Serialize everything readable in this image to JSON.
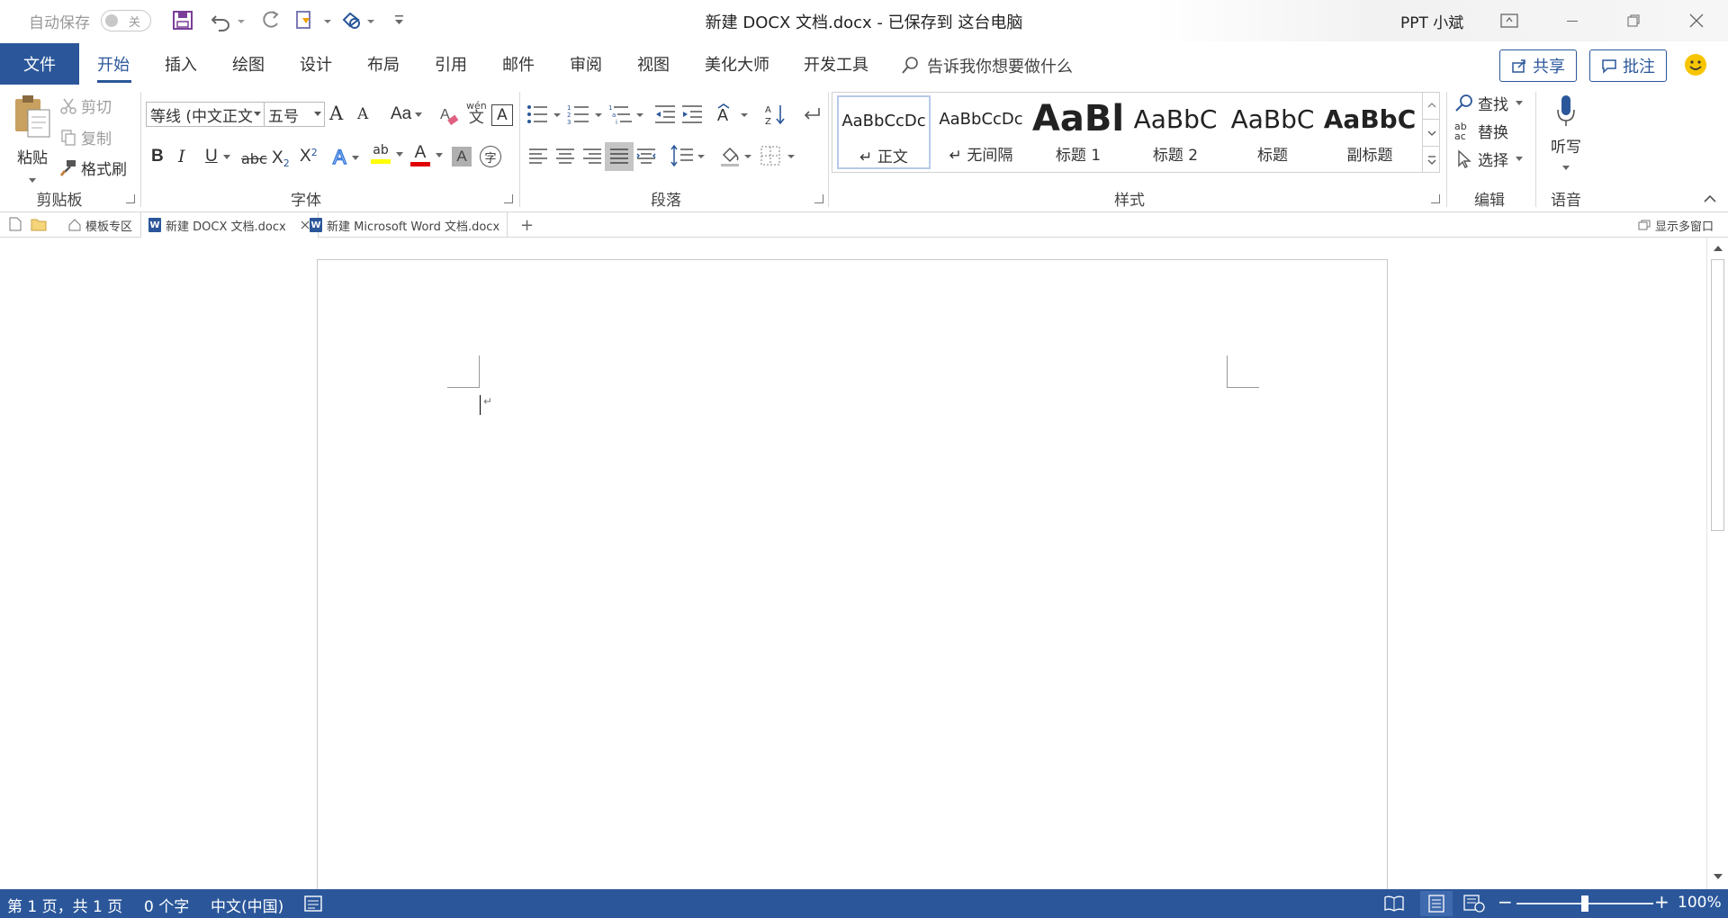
{
  "titlebar": {
    "autosave_label": "自动保存",
    "autosave_state": "关",
    "doc_title": "新建 DOCX 文档.docx  -  已保存到 这台电脑",
    "user": "PPT 小斌"
  },
  "ribbon_tabs": {
    "file": "文件",
    "items": [
      "开始",
      "插入",
      "绘图",
      "设计",
      "布局",
      "引用",
      "邮件",
      "审阅",
      "视图",
      "美化大师",
      "开发工具"
    ],
    "active": "开始",
    "tell_me": "告诉我你想要做什么",
    "share": "共享",
    "comment": "批注"
  },
  "clipboard": {
    "paste": "粘贴",
    "cut": "剪切",
    "copy": "复制",
    "format_painter": "格式刷",
    "label": "剪贴板"
  },
  "font": {
    "name": "等线 (中文正文",
    "size": "五号",
    "grow": "A",
    "shrink": "A",
    "change_case": "Aa",
    "wen": "wén",
    "wen_char": "文",
    "boxed_a": "A",
    "bold": "B",
    "italic": "I",
    "underline": "U",
    "strike": "abc",
    "subscript": "X",
    "sub_mark": "2",
    "superscript": "X",
    "sup_mark": "2",
    "effects": "A",
    "highlight": "ab",
    "font_color": "A",
    "shading": "A",
    "enclose": "字",
    "label": "字体"
  },
  "paragraph": {
    "label": "段落"
  },
  "styles": {
    "items": [
      {
        "sample": "AaBbCcDc",
        "name": "↵ 正文"
      },
      {
        "sample": "AaBbCcDc",
        "name": "↵ 无间隔"
      },
      {
        "sample": "AaBl",
        "name": "标题 1"
      },
      {
        "sample": "AaBbC",
        "name": "标题 2"
      },
      {
        "sample": "AaBbC",
        "name": "标题"
      },
      {
        "sample": "AaBbC",
        "name": "副标题"
      }
    ],
    "label": "样式"
  },
  "editing": {
    "find": "查找",
    "replace": "替换",
    "replace_icon": "ab ac",
    "select": "选择",
    "label": "编辑"
  },
  "voice": {
    "dictate": "听写",
    "label": "语音"
  },
  "doc_tabs": {
    "templates": "模板专区",
    "tab1": "新建 DOCX 文档.docx",
    "tab2": "新建 Microsoft Word 文档.docx",
    "add": "+",
    "multi_window": "显示多窗口",
    "word_letter": "W"
  },
  "document": {
    "para_mark": "↵"
  },
  "statusbar": {
    "page": "第 1 页，共 1 页",
    "words": "0 个字",
    "language": "中文(中国)",
    "zoom": "100%",
    "zoom_minus": "−",
    "zoom_plus": "+",
    "zoom_fraction": 0.5
  },
  "colors": {
    "brand": "#2b579a",
    "highlight_yellow": "#ffff00",
    "font_red": "#e00000"
  }
}
